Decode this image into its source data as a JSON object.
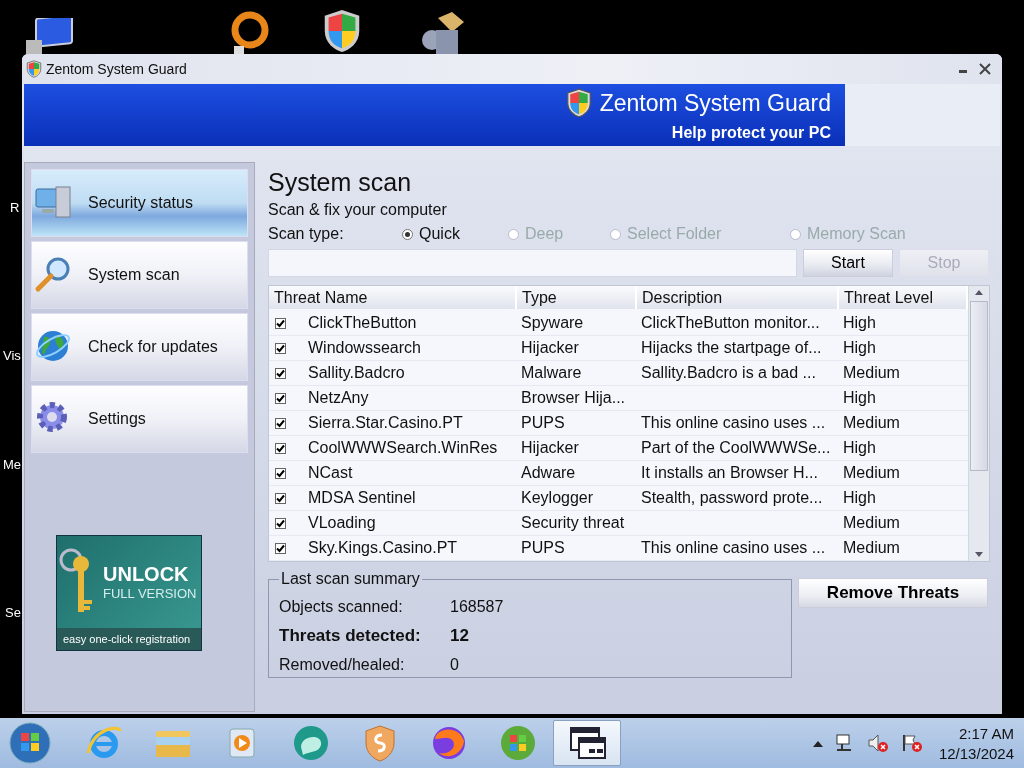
{
  "desktop": {
    "icon_labels": [
      "R",
      "Vis",
      "Me",
      "Se"
    ]
  },
  "window": {
    "title": "Zentom System Guard"
  },
  "banner": {
    "title": "Zentom System Guard",
    "subtitle": "Help protect your PC"
  },
  "sidebar": {
    "items": [
      {
        "label": "Security status",
        "selected": true,
        "kind": "computer"
      },
      {
        "label": "System scan",
        "selected": false,
        "kind": "magnifier"
      },
      {
        "label": "Check for updates",
        "selected": false,
        "kind": "globe"
      },
      {
        "label": "Settings",
        "selected": false,
        "kind": "gear"
      }
    ],
    "promo": {
      "title": "UNLOCK",
      "subtitle": "FULL VERSION",
      "footer": "easy one-click registration"
    }
  },
  "content": {
    "title": "System scan",
    "subtitle": "Scan & fix your computer",
    "scan_type_label": "Scan type:",
    "scan_types": [
      {
        "label": "Quick",
        "selected": true,
        "disabled": false
      },
      {
        "label": "Deep",
        "selected": false,
        "disabled": true
      },
      {
        "label": "Select Folder",
        "selected": false,
        "disabled": true
      },
      {
        "label": "Memory Scan",
        "selected": false,
        "disabled": true
      }
    ],
    "buttons": [
      {
        "label": "Start",
        "disabled": false
      },
      {
        "label": "Stop",
        "disabled": true
      }
    ]
  },
  "table": {
    "columns": [
      "Threat Name",
      "Type",
      "Description",
      "Threat Level"
    ],
    "rows": [
      {
        "checked": true,
        "name": "ClickTheButton",
        "type": "Spyware",
        "description": "ClickTheButton monitor...",
        "level": "High"
      },
      {
        "checked": true,
        "name": "Windowssearch",
        "type": "Hijacker",
        "description": "Hijacks the startpage of...",
        "level": "High"
      },
      {
        "checked": true,
        "name": "Sallity.Badcro",
        "type": "Malware",
        "description": "Sallity.Badcro is a bad ...",
        "level": "Medium"
      },
      {
        "checked": true,
        "name": "NetzAny",
        "type": "Browser Hija...",
        "description": "",
        "level": "High"
      },
      {
        "checked": true,
        "name": "Sierra.Star.Casino.PT",
        "type": "PUPS",
        "description": "This online casino uses ...",
        "level": "Medium"
      },
      {
        "checked": true,
        "name": "CoolWWWSearch.WinRes",
        "type": "Hijacker",
        "description": "Part of the CoolWWWSe...",
        "level": "High"
      },
      {
        "checked": true,
        "name": "NCast",
        "type": "Adware",
        "description": "It installs an Browser H...",
        "level": "Medium"
      },
      {
        "checked": true,
        "name": "MDSA Sentinel",
        "type": "Keylogger",
        "description": "Stealth, password prote...",
        "level": "High"
      },
      {
        "checked": true,
        "name": "VLoading",
        "type": "Security threat",
        "description": "",
        "level": "Medium"
      },
      {
        "checked": true,
        "name": "Sky.Kings.Casino.PT",
        "type": "PUPS",
        "description": "This online casino uses ...",
        "level": "Medium"
      }
    ]
  },
  "summary": {
    "title": "Last scan summary",
    "rows": [
      {
        "label": "Objects scanned:",
        "value": "168587",
        "bold": false
      },
      {
        "label": "Threats detected:",
        "value": "12",
        "bold": true
      },
      {
        "label": "Removed/healed:",
        "value": "0",
        "bold": false
      }
    ]
  },
  "remove_button": "Remove Threats",
  "taskbar": {
    "apps": [
      {
        "kind": "ie",
        "selected": false
      },
      {
        "kind": "folder",
        "selected": false
      },
      {
        "kind": "media",
        "selected": false
      },
      {
        "kind": "bubble",
        "selected": false
      },
      {
        "kind": "shield",
        "selected": false
      },
      {
        "kind": "fox",
        "selected": false
      },
      {
        "kind": "orb",
        "selected": false
      },
      {
        "kind": "window",
        "selected": true
      }
    ],
    "clock": {
      "time": "2:17 AM",
      "date": "12/13/2024"
    }
  }
}
